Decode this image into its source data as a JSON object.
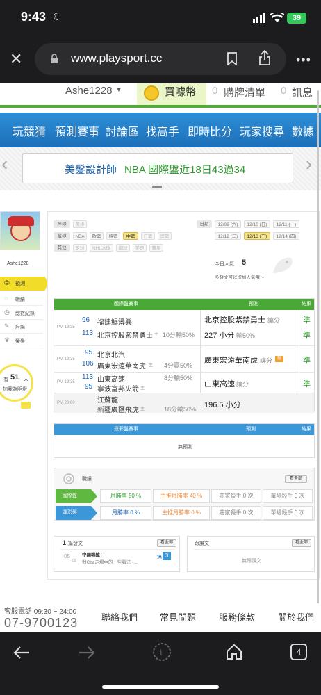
{
  "status": {
    "time": "9:43",
    "battery": "39"
  },
  "browser": {
    "url": "www.playsport.cc",
    "tabs_count": "4"
  },
  "topnav": {
    "username": "Ashe1228",
    "buy": "買噱幣",
    "cart_count": "0",
    "cart": "購牌清單",
    "msg_count": "0",
    "msg": "訊息"
  },
  "mainnav": [
    "玩競猜",
    "預測賽事",
    "討論區",
    "找高手",
    "即時比分",
    "玩家搜尋",
    "數據"
  ],
  "banner": {
    "left": "美髮設計師",
    "right": "NBA 國際盤近18日43過34"
  },
  "sidebar": {
    "username": "Ashe1228",
    "items": [
      "預測",
      "戰績",
      "總數紀錄",
      "討論",
      "榮譽"
    ],
    "fans_prefix": "有",
    "fans_count": "51",
    "fans_unit": "人",
    "fans_label": "加我為明燈"
  },
  "filters": {
    "row1_label": "棒球",
    "row1": [
      "美棒"
    ],
    "row2_label": "籃球",
    "row2": [
      "NBA",
      "歐籃",
      "韓籃",
      "中籃",
      "日籃",
      "澳籃"
    ],
    "row3_label": "其他",
    "row3": [
      "足球",
      "NHL冰球",
      "網球",
      "美足",
      "賽馬"
    ]
  },
  "dates": {
    "label": "日期",
    "items": [
      "12/09 (六)",
      "12/10 (日)",
      "12/11 (一)",
      "12/12 (二)",
      "12/13 (三)",
      "12/14 (四)"
    ]
  },
  "popularity": {
    "label": "今日人氣",
    "value": "5",
    "note": "多發文可以增加人氣哦～"
  },
  "intl_table": {
    "col1": "國際盤賽事",
    "col2": "預測",
    "col3": "結果",
    "rows": [
      {
        "time": "PM 19:35",
        "n1": "96",
        "t1": "福建鱘潯興",
        "n2": "113",
        "t2": "北京控股紫禁勇士",
        "mark": "主",
        "line": "10分輸50%",
        "pick": "北京控股紫禁勇士",
        "pickx": "讓分",
        "pick2": "227 小分",
        "pick2x": "輸50%",
        "r1": "準",
        "r2": "準"
      },
      {
        "time": "PM 19:35",
        "n1": "95",
        "t1": "北京北汽",
        "n2": "106",
        "t2": "廣東宏遠華南虎",
        "mark": "主",
        "line": "4分贏50%",
        "pick": "廣東宏遠華南虎",
        "pickx": "讓分",
        "badge": "殺",
        "r1": "準"
      },
      {
        "time": "PM 19:35",
        "n1": "113",
        "t1": "山東高速",
        "n2": "95",
        "t2": "寧波富邦火箭",
        "mark": "主",
        "line": "8分輸50%",
        "pick": "山東高速",
        "pickx": "讓分",
        "r1": "準"
      },
      {
        "time": "PM 20:00",
        "n1": "",
        "t1": "江蘇龍",
        "n2": "",
        "t2": "新疆廣匯飛虎",
        "mark": "主",
        "line": "18分輸50%",
        "pick": "196.5 小分",
        "r1": ""
      }
    ]
  },
  "lottery_table": {
    "col1": "運彩盤賽事",
    "col2": "預測",
    "col3": "結果",
    "empty": "無預測"
  },
  "record": {
    "title": "戰績",
    "more": "看全部",
    "intl_label": "國際盤",
    "lot_label": "運彩盤",
    "intl": [
      "月勝率 50 %",
      "主推月勝率 40 %",
      "莊家殺手 0 次",
      "單場殺手 0 次"
    ],
    "lot": [
      "月勝率 0 %",
      "主推月勝率 0 %",
      "莊家殺手 0 次",
      "單場殺手 0 次"
    ]
  },
  "posts": {
    "count": "1",
    "label": "篇發文",
    "more": "看全部",
    "date_m": "05",
    "date_d": "09",
    "post_cat": "中國職籃：",
    "post_text": "對Cba走場中的一些看法 -...",
    "reply_label": "搞",
    "reply_count": "3",
    "replies_title": "跟讚文",
    "replies_more": "看全部",
    "replies_empty": "無跟讚文"
  },
  "footer": {
    "service_label": "客服電話 09:30 ~ 24:00",
    "phone": "07-9700123",
    "links": [
      "聯絡我們",
      "常見問題",
      "服務條款",
      "關於我們"
    ]
  }
}
